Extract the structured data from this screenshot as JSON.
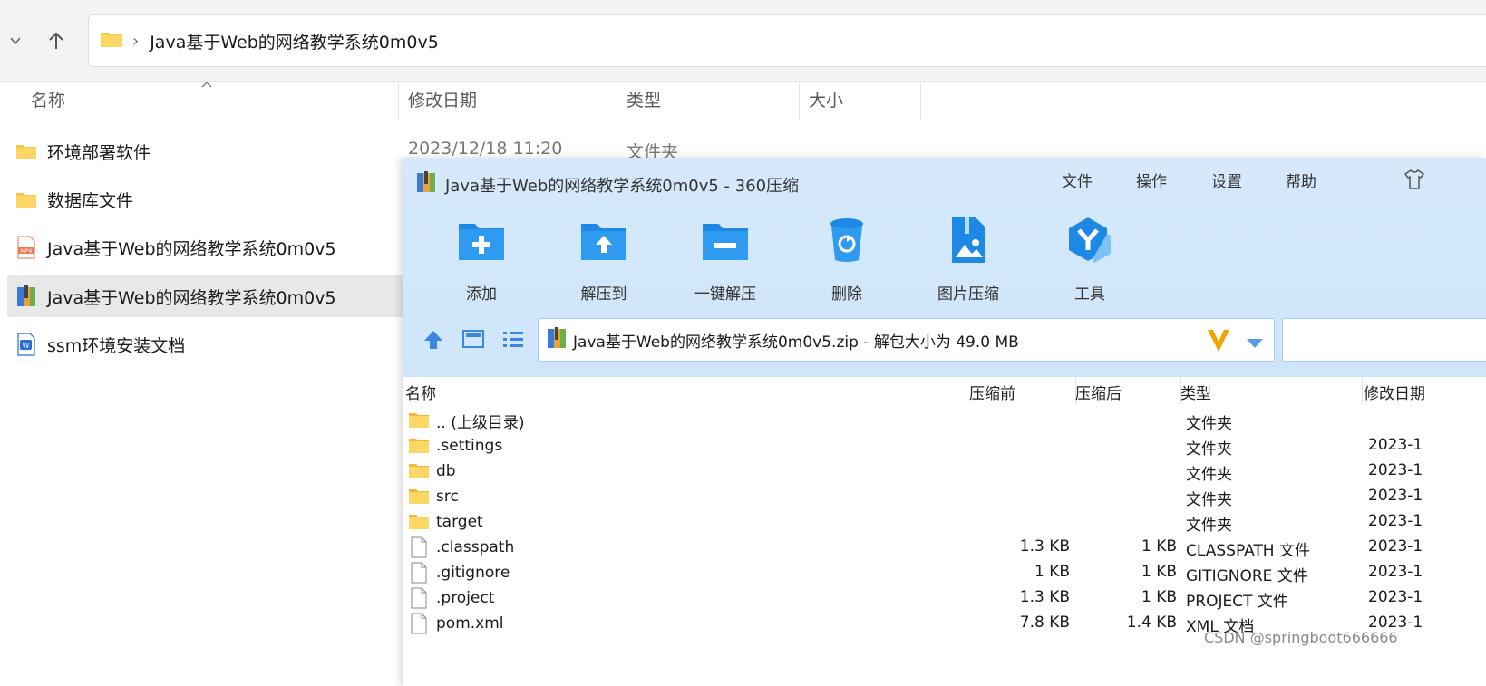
{
  "explorer": {
    "address_path": "Java基于Web的网络教学系统0m0v5",
    "columns": {
      "name": "名称",
      "modified": "修改日期",
      "type": "类型",
      "size": "大小"
    },
    "items": [
      {
        "name": "环境部署软件",
        "icon": "folder-icon"
      },
      {
        "name": "数据库文件",
        "icon": "folder-icon"
      },
      {
        "name": "Java基于Web的网络教学系统0m0v5",
        "icon": "mp4-file-icon"
      },
      {
        "name": "Java基于Web的网络教学系统0m0v5",
        "icon": "zip-archive-icon"
      },
      {
        "name": "ssm环境安装文档",
        "icon": "wps-doc-icon"
      }
    ],
    "first_row_meta": {
      "modified": "2023/12/18 11:20",
      "type": "文件夹"
    }
  },
  "zip_window": {
    "title": "Java基于Web的网络教学系统0m0v5 - 360压缩",
    "menu": [
      "文件",
      "操作",
      "设置",
      "帮助"
    ],
    "toolbar": [
      {
        "label": "添加",
        "icon": "add-folder-icon"
      },
      {
        "label": "解压到",
        "icon": "extract-to-icon"
      },
      {
        "label": "一键解压",
        "icon": "one-click-extract-icon"
      },
      {
        "label": "删除",
        "icon": "delete-icon"
      },
      {
        "label": "图片压缩",
        "icon": "image-compress-icon"
      },
      {
        "label": "工具",
        "icon": "tools-icon"
      }
    ],
    "path": "Java基于Web的网络教学系统0m0v5.zip - 解包大小为 49.0 MB",
    "columns": {
      "name": "名称",
      "before": "压缩前",
      "after": "压缩后",
      "type": "类型",
      "modified": "修改日期"
    },
    "files": [
      {
        "name": ".. (上级目录)",
        "before": "",
        "after": "",
        "type": "文件夹",
        "date": "",
        "icon": "folder-icon"
      },
      {
        "name": ".settings",
        "before": "",
        "after": "",
        "type": "文件夹",
        "date": "2023-1",
        "icon": "folder-icon"
      },
      {
        "name": "db",
        "before": "",
        "after": "",
        "type": "文件夹",
        "date": "2023-1",
        "icon": "folder-icon"
      },
      {
        "name": "src",
        "before": "",
        "after": "",
        "type": "文件夹",
        "date": "2023-1",
        "icon": "folder-icon"
      },
      {
        "name": "target",
        "before": "",
        "after": "",
        "type": "文件夹",
        "date": "2023-1",
        "icon": "folder-icon"
      },
      {
        "name": ".classpath",
        "before": "1.3 KB",
        "after": "1 KB",
        "type": "CLASSPATH 文件",
        "date": "2023-1",
        "icon": "file-icon"
      },
      {
        "name": ".gitignore",
        "before": "1 KB",
        "after": "1 KB",
        "type": "GITIGNORE 文件",
        "date": "2023-1",
        "icon": "file-icon"
      },
      {
        "name": ".project",
        "before": "1.3 KB",
        "after": "1 KB",
        "type": "PROJECT 文件",
        "date": "2023-1",
        "icon": "file-icon"
      },
      {
        "name": "pom.xml",
        "before": "7.8 KB",
        "after": "1.4 KB",
        "type": "XML 文档",
        "date": "2023-1",
        "icon": "file-icon"
      }
    ]
  },
  "watermark": "CSDN @springboot666666",
  "colors": {
    "folder": "#f7c84a",
    "accent": "#1e88e5",
    "zip_bg": "#d6e9fb"
  }
}
